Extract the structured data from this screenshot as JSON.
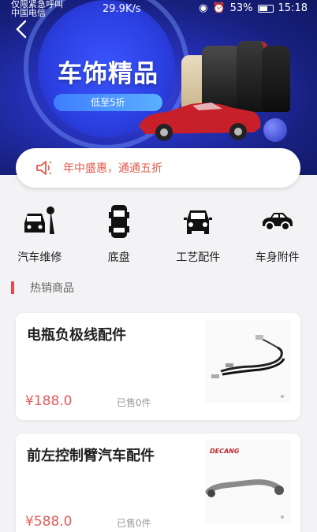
{
  "status_bar": {
    "carrier_line1": "仅限紧急呼叫",
    "carrier_line2": "中国电信",
    "network_speed": "29.9K/s",
    "battery": "53%",
    "time": "15:18"
  },
  "banner": {
    "title": "车饰精品",
    "subtitle": "低至5折"
  },
  "notice": {
    "text": "年中盛惠，通通五折"
  },
  "categories": [
    {
      "label": "汽车维修",
      "icon": "car-repair-icon"
    },
    {
      "label": "底盘",
      "icon": "chassis-icon"
    },
    {
      "label": "工艺配件",
      "icon": "car-front-icon"
    },
    {
      "label": "车身附件",
      "icon": "car-side-icon"
    }
  ],
  "section": {
    "title": "热销商品"
  },
  "products": [
    {
      "name": "电瓶负极线配件",
      "price": "¥188.0",
      "sold": "已售0件",
      "image": "battery-cable-image"
    },
    {
      "name": "前左控制臂汽车配件",
      "price": "¥588.0",
      "sold": "已售0件",
      "image": "control-arm-image",
      "brand": "DECANG"
    }
  ],
  "colors": {
    "accent": "#e45b5b",
    "banner_blue": "#2530b8"
  }
}
